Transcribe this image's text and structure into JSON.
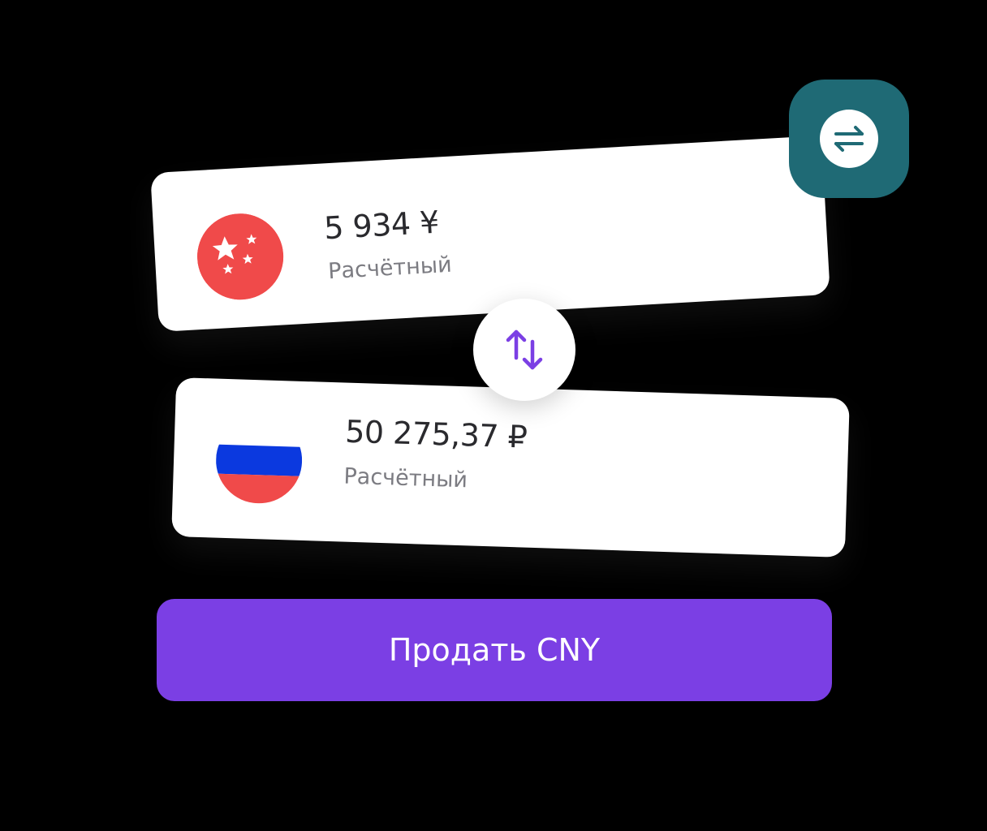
{
  "from_account": {
    "currency_code": "CNY",
    "flag_icon": "china-flag-icon",
    "amount": "5 934 ¥",
    "account_type": "Расчётный"
  },
  "to_account": {
    "currency_code": "RUB",
    "flag_icon": "russia-flag-icon",
    "amount": "50 275,37 ₽",
    "account_type": "Расчётный"
  },
  "swap_icon": "swap-vertical-icon",
  "exchange_icon": "exchange-arrows-icon",
  "action_button": {
    "label": "Продать CNY"
  },
  "colors": {
    "button": "#7b3fe4",
    "exchange_badge": "#1f6a75",
    "china_red": "#f04a4a",
    "russia_blue": "#0b39df",
    "swap_arrows": "#7b3fe4"
  }
}
